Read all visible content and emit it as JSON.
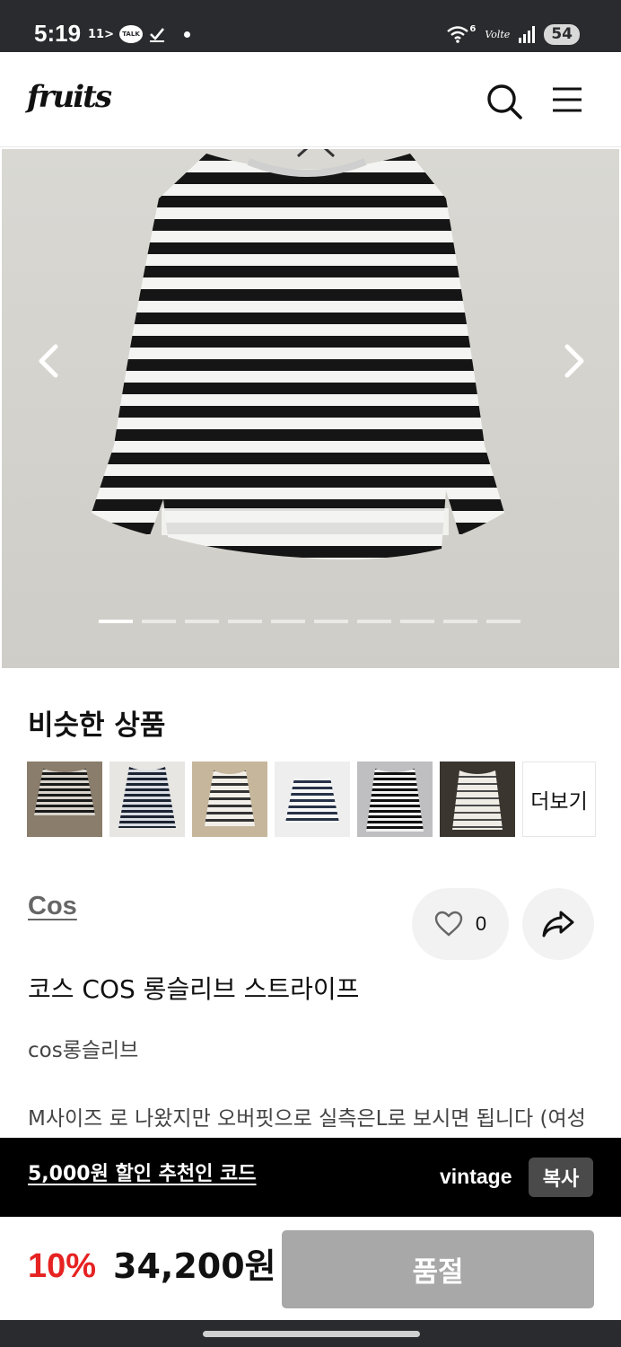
{
  "status_bar": {
    "time": "5:19",
    "carrier_icon": "11>",
    "talk_label": "TALK",
    "wifi_sub": "6",
    "volte": "Volte",
    "battery": "54"
  },
  "header": {
    "logo": "fruits",
    "icons": [
      "search-icon",
      "menu-icon"
    ]
  },
  "gallery": {
    "image_count": 10,
    "active_index": 0,
    "icons": [
      "chevron-left-icon",
      "chevron-right-icon"
    ]
  },
  "similar": {
    "title": "비슷한 상품",
    "more_label": "더보기",
    "thumbnail_count": 6
  },
  "product": {
    "brand": "Cos",
    "like_count": "0",
    "name": "코스 COS 롱슬리브 스트라이프",
    "tag": "cos롱슬리브",
    "description": "M사이즈 로 나왔지만 오버핏으로 실측은L로 보시면 됩니다 (여성"
  },
  "referral": {
    "text": "5,000원 할인 추천인 코드",
    "code": "vintage",
    "copy_label": "복사"
  },
  "purchase": {
    "discount": "10%",
    "price": "34,200원",
    "soldout_label": "품절"
  },
  "colors": {
    "discount": "#e62222",
    "soldout_button": "#a8a8a8",
    "banner_bg": "#000000"
  }
}
